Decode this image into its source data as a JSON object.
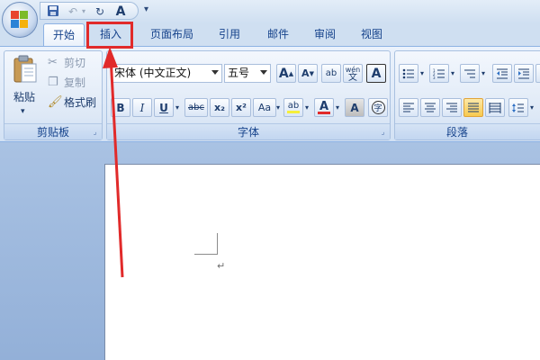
{
  "quick_access": {
    "save_icon": "save-icon",
    "undo_icon": "undo-icon",
    "redo_icon": "redo-icon",
    "font_label": "A",
    "customize_label": "▾"
  },
  "tabs": [
    {
      "label": "开始",
      "active": true
    },
    {
      "label": "插入",
      "active": false,
      "highlighted": true
    },
    {
      "label": "页面布局",
      "active": false
    },
    {
      "label": "引用",
      "active": false
    },
    {
      "label": "邮件",
      "active": false
    },
    {
      "label": "审阅",
      "active": false
    },
    {
      "label": "视图",
      "active": false
    }
  ],
  "clipboard": {
    "group_label": "剪贴板",
    "paste_label": "粘贴",
    "cut_label": "剪切",
    "copy_label": "复制",
    "format_painter_label": "格式刷"
  },
  "font": {
    "group_label": "字体",
    "font_name": "宋体 (中文正文)",
    "font_size": "五号",
    "grow_label": "A",
    "shrink_label": "A",
    "clear_label": "ab",
    "phonetic_label": "wén",
    "phonetic_char": "文",
    "border_label": "A",
    "bold": "B",
    "italic": "I",
    "underline": "U",
    "strike": "abc",
    "subscript": "x₂",
    "superscript": "x²",
    "change_case": "Aa",
    "highlight": "ab",
    "font_color": "A",
    "shading": "A",
    "enclose": "字"
  },
  "paragraph": {
    "group_label": "段落"
  },
  "document": {
    "paragraph_mark": "↵"
  },
  "colors": {
    "highlight_box": "#e12a2a",
    "arrow": "#e12a2a",
    "font_color_bar": "#e12a2a",
    "highlight_color_bar": "#f5ef3a"
  }
}
